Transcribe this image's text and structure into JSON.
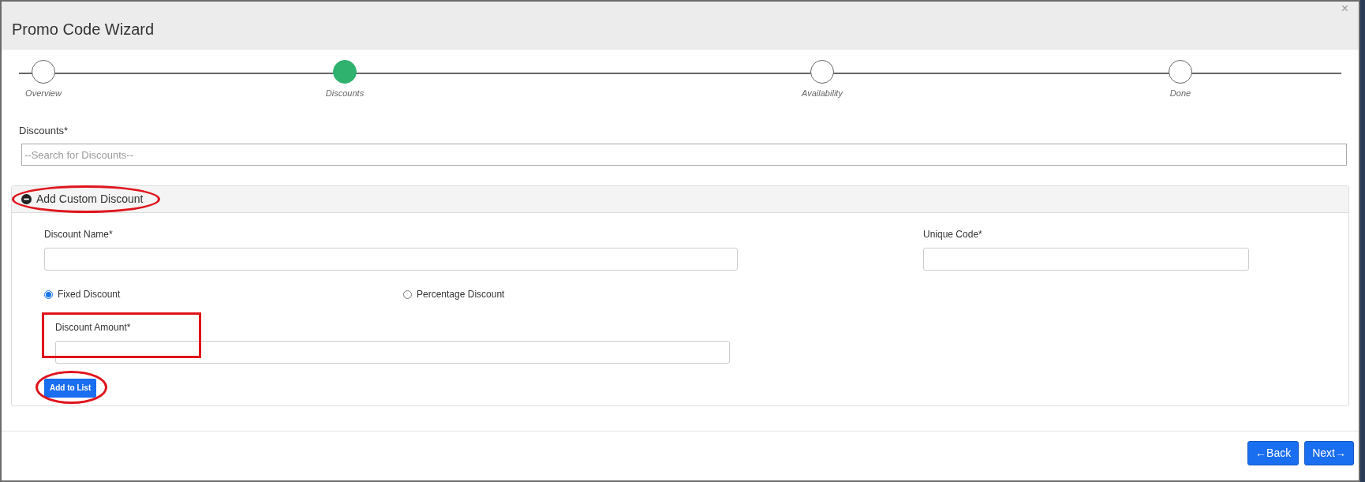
{
  "window": {
    "title": "Promo Code Wizard",
    "close": "×"
  },
  "steps": [
    {
      "label": "Overview",
      "selected": false
    },
    {
      "label": "Discounts",
      "selected": true
    },
    {
      "label": "Availability",
      "selected": false
    },
    {
      "label": "Done",
      "selected": false
    }
  ],
  "discounts": {
    "label": "Discounts*",
    "placeholder": "--Search for Discounts--"
  },
  "custom_panel": {
    "title": "Add Custom Discount",
    "expanded": true,
    "circled": true,
    "discount_name": {
      "label": "Discount Name*"
    },
    "unique_code": {
      "label": "Unique Code*"
    },
    "options": [
      {
        "label": "Fixed Discount",
        "selected": true
      },
      {
        "label": "Percentage Discount",
        "selected": false
      }
    ],
    "discount_amount": {
      "label": "Discount Amount*",
      "boxed": true
    },
    "add_button": {
      "label": "Add to List",
      "circled": true
    }
  },
  "footer": {
    "buttons": [
      "←Back",
      "Next→"
    ]
  }
}
